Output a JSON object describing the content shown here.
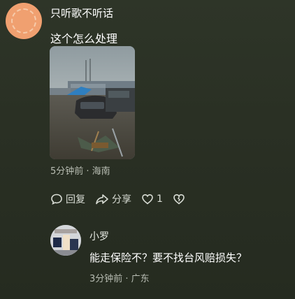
{
  "comment": {
    "username": "只听歌不听话",
    "text": "这个怎么处理",
    "meta": "5分钟前 · 海南",
    "actions": {
      "reply_label": "回复",
      "share_label": "分享",
      "like_count": "1"
    }
  },
  "reply": {
    "username": "小罗",
    "text": "能走保险不？要不找台风赔损失？",
    "meta": "3分钟前 · 广东"
  },
  "icons": {
    "reply": "comment-bubble-icon",
    "share": "share-arrow-icon",
    "like": "heart-icon",
    "dislike": "broken-heart-icon"
  },
  "colors": {
    "background": "#2a3024",
    "avatar": "#f0a070",
    "meta_text": "#b8bdb3"
  }
}
